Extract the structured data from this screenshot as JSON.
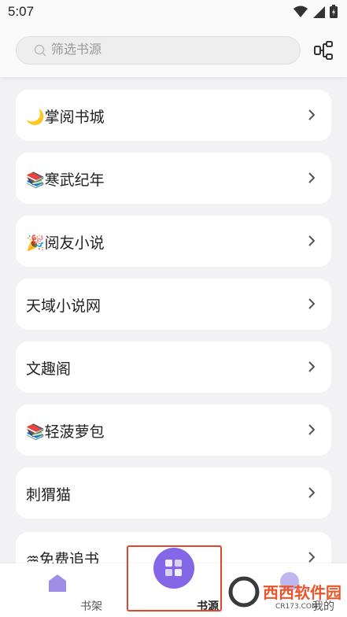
{
  "status_bar": {
    "time": "5:07"
  },
  "search": {
    "placeholder": "筛选书源",
    "value": ""
  },
  "sources": [
    {
      "emoji": "🌙",
      "name": "掌阅书城"
    },
    {
      "emoji": "📚",
      "name": "寒武纪年"
    },
    {
      "emoji": "🎉",
      "name": "阅友小说"
    },
    {
      "emoji": "",
      "name": "天域小说网"
    },
    {
      "emoji": "",
      "name": "文趣阁"
    },
    {
      "emoji": "📚",
      "name": "轻菠萝包"
    },
    {
      "emoji": "",
      "name": "刺猬猫"
    },
    {
      "emoji": "♒",
      "name": "免费追书"
    }
  ],
  "bottom_nav": {
    "items": [
      {
        "label": "书架",
        "icon": "bookshelf-icon"
      },
      {
        "label": "书源",
        "icon": "source-grid-icon",
        "active": true
      },
      {
        "label": "我的",
        "icon": "profile-icon"
      }
    ]
  },
  "colors": {
    "accent": "#8467e6",
    "highlight": "#e0452e",
    "background": "#f2f2f4"
  },
  "watermark": {
    "text": "西西软件园",
    "subtext": "CR173.COM"
  }
}
